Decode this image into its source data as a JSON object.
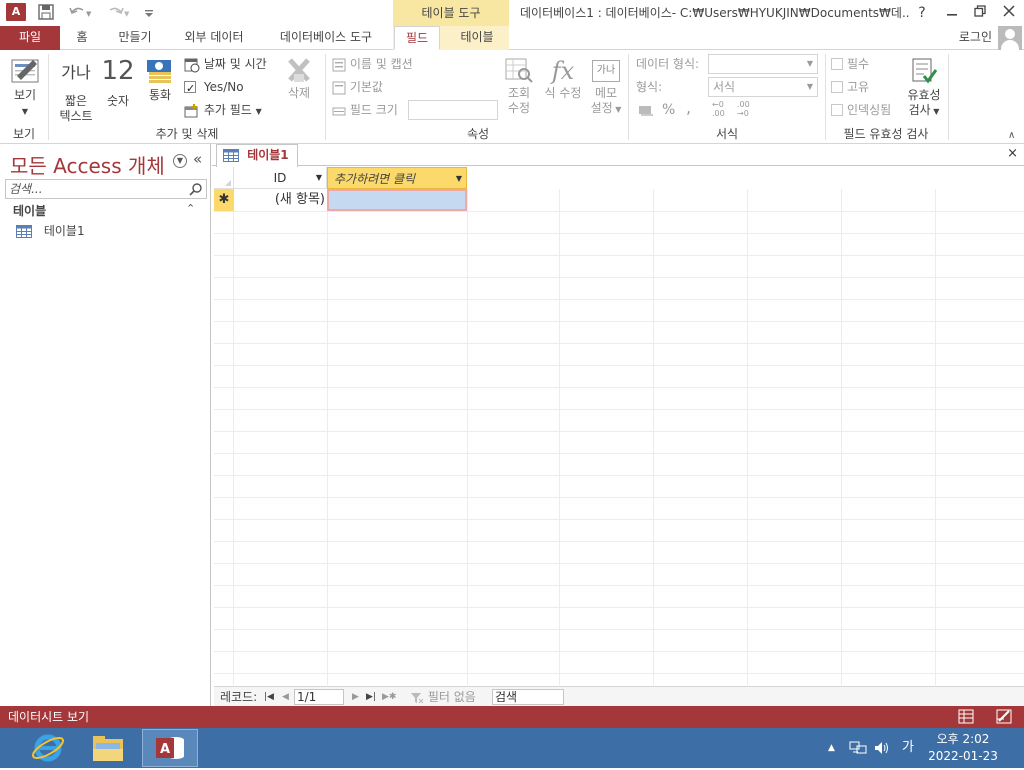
{
  "titlebar": {
    "app_icon": "A",
    "context_tool_title": "테이블 도구",
    "window_title": "데이터베이스1 : 데이터베이스- C:₩Users₩HYUKJIN₩Documents₩데...",
    "help": "?",
    "icons": [
      "access-app-icon",
      "save-icon",
      "undo-icon",
      "redo-icon",
      "customize-qat-icon",
      "minimize-icon",
      "restore-icon",
      "close-icon"
    ]
  },
  "tabs": {
    "file": "파일",
    "home": "홈",
    "create": "만들기",
    "external": "외부 데이터",
    "dbtools": "데이터베이스 도구",
    "field": "필드",
    "table": "테이블",
    "login": "로그인"
  },
  "ribbon": {
    "views": {
      "view": "보기",
      "group": "보기"
    },
    "add_delete": {
      "short_text_icon": "가나",
      "short_text_1": "짧은",
      "short_text_2": "텍스트",
      "number_icon": "12",
      "number": "숫자",
      "currency": "통화",
      "datetime": "날짜 및 시간",
      "yesno": "Yes/No",
      "more_fields": "추가 필드",
      "delete": "삭제",
      "group": "추가 및 삭제"
    },
    "properties": {
      "name_caption": "이름 및 캡션",
      "default_value": "기본값",
      "field_size": "필드 크기",
      "lookup_1": "조회",
      "lookup_2": "수정",
      "expression": "식 수정",
      "memo_icon": "가나",
      "memo_1": "메모",
      "memo_2": "설정",
      "group": "속성"
    },
    "formatting": {
      "data_type_label": "데이터 형식:",
      "format_label": "형식:",
      "format_value": "서식",
      "percent": "%",
      "comma": ",",
      "dec_increase": "←0 .00",
      "dec_decrease": ".00 →0",
      "group": "서식"
    },
    "validation": {
      "required": "필수",
      "unique": "고유",
      "indexed": "인덱싱됨",
      "validation_1": "유효성",
      "validation_2": "검사",
      "group": "필드 유효성 검사"
    }
  },
  "nav": {
    "title": "모든 Access 개체",
    "search_placeholder": "검색...",
    "group": "테이블",
    "items": [
      {
        "label": "테이블1"
      }
    ]
  },
  "document": {
    "tab": "테이블1",
    "close": "×"
  },
  "datasheet": {
    "columns": [
      {
        "label": "ID"
      },
      {
        "label": "추가하려면 클릭"
      }
    ],
    "new_row": {
      "selector": "✱",
      "id": "(새 항목)"
    }
  },
  "record_nav": {
    "label": "레코드:",
    "current": "1/1",
    "filter": "필터 없음",
    "search": "검색"
  },
  "status": {
    "text": "데이터시트 보기"
  },
  "taskbar": {
    "ime": "가",
    "time": "오후 2:02",
    "date": "2022-01-23"
  },
  "colors": {
    "accent": "#a4373a",
    "context_tab": "#f8e6a3",
    "taskbar": "#3d6fa6",
    "header_highlight": "#fbd96a",
    "selected_cell": "#c5d9f1"
  }
}
